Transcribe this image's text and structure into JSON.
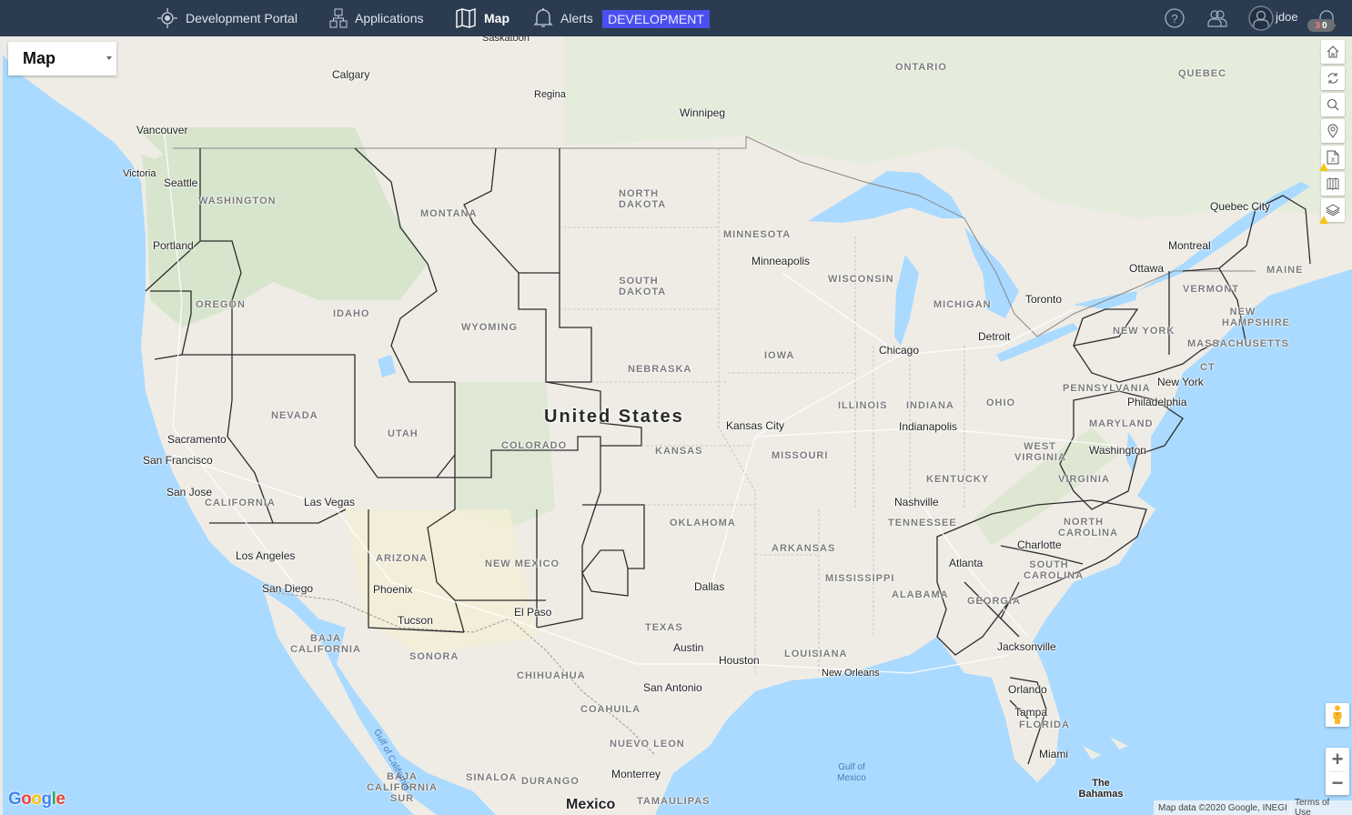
{
  "topbar": {
    "nav": [
      {
        "label": "Development Portal",
        "icon": "portal-icon"
      },
      {
        "label": "Applications",
        "icon": "sitemap-icon"
      },
      {
        "label": "Map",
        "icon": "map-icon",
        "active": true
      },
      {
        "label": "Alerts",
        "icon": "bell-icon"
      }
    ],
    "environment": "DEVELOPMENT",
    "environment_color": "#4a4ff0",
    "username": "jdoe",
    "notifications": {
      "red": "3",
      "white": "0"
    },
    "background": "#2b3b50"
  },
  "map": {
    "type_selector": "Map",
    "tools": [
      "home-icon",
      "refresh-icon",
      "search-icon",
      "location-pin-icon",
      "excel-export-icon",
      "map-layout-icon",
      "layers-icon"
    ],
    "zoom_in": "+",
    "zoom_out": "−",
    "attribution": "Map data ©2020 Google, INEGI",
    "terms": "Terms of Use",
    "logo": "Google",
    "country_label": "United States",
    "country_label_mexico": "Mexico",
    "cities": [
      "Saskatoon",
      "Calgary",
      "Regina",
      "Winnipeg",
      "Vancouver",
      "Victoria",
      "Seattle",
      "Portland",
      "Sacramento",
      "San Francisco",
      "San Jose",
      "Las Vegas",
      "Los Angeles",
      "San Diego",
      "Phoenix",
      "Tucson",
      "El Paso",
      "Minneapolis",
      "Chicago",
      "Detroit",
      "Toronto",
      "Ottawa",
      "Montreal",
      "Quebec City",
      "Kansas City",
      "Indianapolis",
      "Nashville",
      "Atlanta",
      "Charlotte",
      "Washington",
      "Philadelphia",
      "New York",
      "Dallas",
      "Austin",
      "Houston",
      "San Antonio",
      "New Orleans",
      "Jacksonville",
      "Orlando",
      "Tampa",
      "Miami",
      "Monterrey"
    ],
    "regions": [
      "ONTARIO",
      "QUEBEC",
      "NORTH DAKOTA",
      "SOUTH DAKOTA",
      "MONTANA",
      "WASHINGTON",
      "OREGON",
      "IDAHO",
      "WYOMING",
      "NEVADA",
      "UTAH",
      "COLORADO",
      "CALIFORNIA",
      "ARIZONA",
      "NEW MEXICO",
      "NEBRASKA",
      "KANSAS",
      "OKLAHOMA",
      "TEXAS",
      "MINNESOTA",
      "IOWA",
      "MISSOURI",
      "ARKANSAS",
      "LOUISIANA",
      "MISSISSIPPI",
      "ALABAMA",
      "GEORGIA",
      "FLORIDA",
      "TENNESSEE",
      "KENTUCKY",
      "ILLINOIS",
      "INDIANA",
      "OHIO",
      "WISCONSIN",
      "MICHIGAN",
      "PENNSYLVANIA",
      "NEW YORK",
      "VERMONT",
      "NEW HAMPSHIRE",
      "MAINE",
      "MASSACHUSETTS",
      "CT",
      "MARYLAND",
      "WEST VIRGINIA",
      "VIRGINIA",
      "NORTH CAROLINA",
      "SOUTH CAROLINA",
      "BAJA CALIFORNIA",
      "SONORA",
      "CHIHUAHUA",
      "COAHUILA",
      "NUEVO LEON",
      "SINALOA",
      "DURANGO",
      "BAJA CALIFORNIA SUR",
      "TAMAULIPAS",
      "The Bahamas"
    ],
    "water_labels": [
      "Gulf of California",
      "Gulf of Mexico"
    ]
  }
}
